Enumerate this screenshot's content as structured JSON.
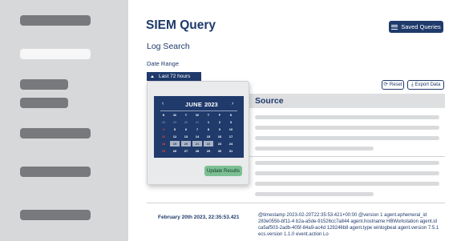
{
  "header": {
    "title": "SIEM Query",
    "saved_queries_label": "Saved Queries",
    "subtitle": "Log Search"
  },
  "filters": {
    "date_range_label": "Date Range",
    "date_range_value": "Last 72 hours"
  },
  "toolbar": {
    "reset_label": "Reset",
    "export_label": "Export Data"
  },
  "table": {
    "source_header": "Source",
    "row": {
      "date": "February 20th 2023, 22:35:53.421",
      "source": "@timestamp 2023-02-20T22:35:53.421+00:00 @version 1 agent.ephemeral_id 283e055b-bf11-4 b2a-a5de-91526cc7a844 agent.hostname HBWorkstation agent.id ca5af503-2adb-405f-84a9-ac4d 129246b8 agent.type winlogbeat agent.version 7.5.1 ecs.version 1.1.0 event.action Lo"
    }
  },
  "calendar": {
    "prev_glyph": "‹",
    "month": "JUNE",
    "year": "2023",
    "next_glyph": "›",
    "weekdays": [
      "S",
      "M",
      "T",
      "W",
      "T",
      "F",
      "S"
    ],
    "weeks": [
      [
        "28",
        "29",
        "30",
        "31",
        "1",
        "2",
        "3"
      ],
      [
        "4",
        "5",
        "6",
        "7",
        "8",
        "9",
        "10"
      ],
      [
        "11",
        "12",
        "13",
        "14",
        "15",
        "16",
        "17"
      ],
      [
        "18",
        "19",
        "20",
        "21",
        "22",
        "23",
        "24"
      ],
      [
        "25",
        "26",
        "27",
        "28",
        "29",
        "30",
        "31"
      ]
    ],
    "selected_days": [
      "19",
      "20",
      "21",
      "22"
    ],
    "update_label": "Update Results"
  },
  "icons": {
    "saved_queries": "list-icon",
    "date_range": "caret-up-icon",
    "reset": "refresh-icon",
    "export": "download-icon",
    "reset_glyph": "⟳",
    "export_glyph": "⤓"
  },
  "colors": {
    "primary": "#1f3a6b",
    "sidebar": "#d7d8da",
    "update_button": "#7bbf93",
    "weekend": "#e0493c"
  }
}
